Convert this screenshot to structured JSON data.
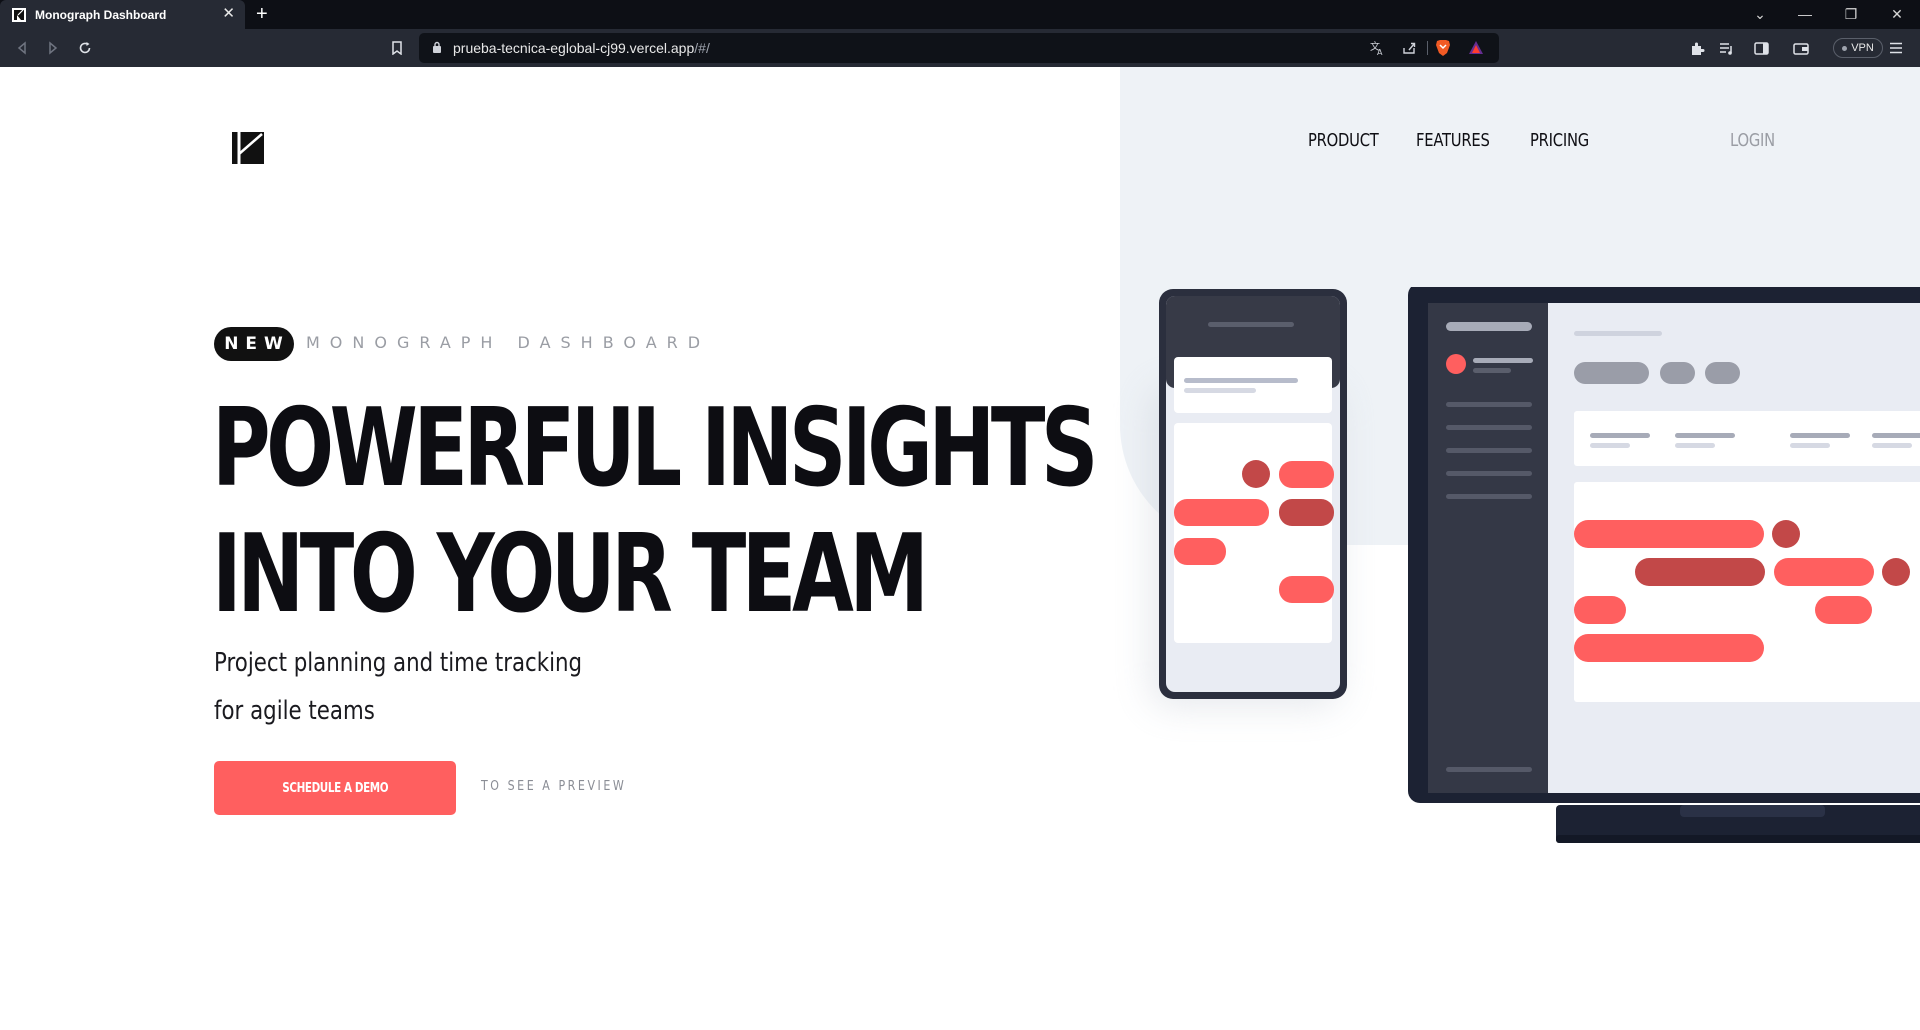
{
  "browser": {
    "tab_title": "Monograph Dashboard",
    "tab_close": "✕",
    "new_tab": "+",
    "url_host": "prueba-tecnica-eglobal-cj99.vercel.app",
    "url_path": "/#/",
    "vpn_label": "VPN",
    "window_controls": {
      "tabs_menu": "⌄",
      "minimize": "—",
      "restore": "❐",
      "close": "✕"
    }
  },
  "nav": {
    "product": "PRODUCT",
    "features": "FEATURES",
    "pricing": "PRICING",
    "login": "LOGIN"
  },
  "hero": {
    "badge": "NEW",
    "eyebrow": "MONOGRAPH DASHBOARD",
    "headline_line1": "POWERFUL INSIGHTS",
    "headline_line2": "INTO YOUR TEAM",
    "subtitle_line1": "Project planning and time tracking",
    "subtitle_line2": "for agile teams",
    "cta_label": "SCHEDULE A DEMO",
    "secondary_link": "TO SEE A PREVIEW"
  },
  "colors": {
    "accent": "#ff5f5f",
    "accent_dark": "#c24848",
    "text_dark": "#0d0d12",
    "muted": "#9a9da4",
    "hero_panel": "#eef2f6",
    "device_frame": "#2b2f3e"
  }
}
